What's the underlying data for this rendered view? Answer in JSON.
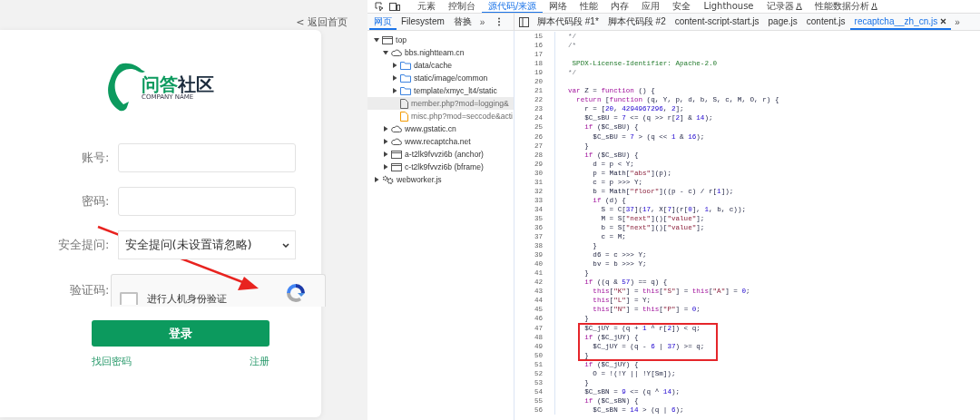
{
  "login_page": {
    "back_link": "< 返回首页",
    "logo": {
      "name_parts": [
        "问答",
        "社区"
      ],
      "tagline": "COMPANY NAME"
    },
    "fields": [
      {
        "kind": "text",
        "label": "账号:"
      },
      {
        "kind": "password",
        "label": "密码:"
      },
      {
        "kind": "select",
        "label": "安全提问:",
        "value": "安全提问(未设置请忽略)"
      },
      {
        "kind": "captcha",
        "label": "验证码:",
        "checkbox_label": "进行人机身份验证",
        "checked": false
      }
    ],
    "submit": "登录",
    "links": [
      "找回密码",
      "注册"
    ]
  },
  "devtools": {
    "panel_tabs": [
      {
        "label": "元素",
        "selected": false,
        "experimental": false
      },
      {
        "label": "控制台",
        "selected": false,
        "experimental": false
      },
      {
        "label": "源代码/来源",
        "selected": true,
        "experimental": false
      },
      {
        "label": "网络",
        "selected": false,
        "experimental": false
      },
      {
        "label": "性能",
        "selected": false,
        "experimental": false
      },
      {
        "label": "内存",
        "selected": false,
        "experimental": false
      },
      {
        "label": "应用",
        "selected": false,
        "experimental": false
      },
      {
        "label": "安全",
        "selected": false,
        "experimental": false
      },
      {
        "label": "Lighthouse",
        "selected": false,
        "experimental": false
      },
      {
        "label": "记录器",
        "selected": false,
        "experimental": true
      },
      {
        "label": "性能数据分析",
        "selected": false,
        "experimental": true
      }
    ],
    "navigator_tabs": [
      {
        "label": "网页",
        "selected": true
      },
      {
        "label": "Filesystem",
        "selected": false
      },
      {
        "label": "替换",
        "selected": false
      }
    ],
    "navigator_more": "»",
    "editor_tabs": [
      {
        "label": "脚本代码段 #1*",
        "selected": false
      },
      {
        "label": "脚本代码段 #2",
        "selected": false
      },
      {
        "label": "content-script-start.js",
        "selected": false
      },
      {
        "label": "page.js",
        "selected": false
      },
      {
        "label": "content.js",
        "selected": false
      },
      {
        "label": "recaptcha__zh_cn.js",
        "selected": true
      }
    ],
    "editor_more": "»",
    "file_tree": [
      {
        "label": "top",
        "kind": "frame",
        "expanded": true,
        "selected": false,
        "children": [
          {
            "label": "bbs.nightteam.cn",
            "kind": "domain",
            "expanded": true,
            "selected": false,
            "children": [
              {
                "label": "data/cache",
                "kind": "folder",
                "expanded": false,
                "selected": false
              },
              {
                "label": "static/image/common",
                "kind": "folder",
                "expanded": false,
                "selected": false
              },
              {
                "label": "template/xmyc_lt4/static",
                "kind": "folder",
                "expanded": false,
                "selected": false
              },
              {
                "label": "member.php?mod=logging&",
                "kind": "file",
                "selected": true
              },
              {
                "label": "misc.php?mod=seccode&acti",
                "kind": "script",
                "selected": false
              }
            ]
          },
          {
            "label": "www.gstatic.cn",
            "kind": "domain",
            "expanded": false,
            "selected": false
          },
          {
            "label": "www.recaptcha.net",
            "kind": "domain",
            "expanded": false,
            "selected": false
          },
          {
            "label": "a-t2lk9fvvzi6b (anchor)",
            "kind": "frame",
            "expanded": false,
            "selected": false
          },
          {
            "label": "c-t2lk9fvvzi6b (bframe)",
            "kind": "frame",
            "expanded": false,
            "selected": false
          }
        ]
      },
      {
        "label": "webworker.js",
        "kind": "worker",
        "expanded": false,
        "selected": false
      }
    ],
    "code_lines": [
      {
        "number": "15",
        "segments": [
          {
            "kind": "comment",
            "text": "*/"
          }
        ]
      },
      {
        "number": "16",
        "segments": [
          {
            "kind": "comment",
            "text": "/*"
          }
        ]
      },
      {
        "number": "17"
      },
      {
        "number": "18",
        "segments": [
          {
            "kind": "license",
            "text": " SPDX-License-Identifier: Apache-2.0"
          }
        ]
      },
      {
        "number": "19",
        "segments": [
          {
            "kind": "comment",
            "text": "*/"
          }
        ]
      },
      {
        "number": "20"
      },
      {
        "number": "21",
        "segments": [
          {
            "kind": "keyword",
            "text": "var"
          },
          {
            "kind": "plain",
            "text": " Z = "
          },
          {
            "kind": "keyword",
            "text": "function"
          },
          {
            "kind": "plain",
            "text": " () {"
          }
        ]
      },
      {
        "number": "22",
        "segments": [
          {
            "kind": "keyword",
            "text": "  return"
          },
          {
            "kind": "plain",
            "text": " ["
          },
          {
            "kind": "keyword",
            "text": "function"
          },
          {
            "kind": "plain",
            "text": " (q, Y, p, d, b, S, c, M, O, r) {"
          }
        ]
      },
      {
        "number": "23",
        "segments": [
          {
            "kind": "plain",
            "text": "    r = ["
          },
          {
            "kind": "number",
            "text": "20"
          },
          {
            "kind": "plain",
            "text": ", "
          },
          {
            "kind": "number",
            "text": "4294967296"
          },
          {
            "kind": "plain",
            "text": ", "
          },
          {
            "kind": "number",
            "text": "2"
          },
          {
            "kind": "plain",
            "text": "];"
          }
        ]
      },
      {
        "number": "24",
        "segments": [
          {
            "kind": "plain",
            "text": "    $C_sBU = "
          },
          {
            "kind": "number",
            "text": "7"
          },
          {
            "kind": "plain",
            "text": " <= (q >> r["
          },
          {
            "kind": "number",
            "text": "2"
          },
          {
            "kind": "plain",
            "text": "] & "
          },
          {
            "kind": "number",
            "text": "14"
          },
          {
            "kind": "plain",
            "text": ");"
          }
        ]
      },
      {
        "number": "25",
        "segments": [
          {
            "kind": "keyword",
            "text": "    if"
          },
          {
            "kind": "plain",
            "text": " ($C_sBU) {"
          }
        ]
      },
      {
        "number": "26",
        "segments": [
          {
            "kind": "plain",
            "text": "      $C_sBU = "
          },
          {
            "kind": "number",
            "text": "7"
          },
          {
            "kind": "plain",
            "text": " > (q << "
          },
          {
            "kind": "number",
            "text": "1"
          },
          {
            "kind": "plain",
            "text": " & "
          },
          {
            "kind": "number",
            "text": "16"
          },
          {
            "kind": "plain",
            "text": ");"
          }
        ]
      },
      {
        "number": "27",
        "segments": [
          {
            "kind": "plain",
            "text": "    }"
          }
        ]
      },
      {
        "number": "28",
        "segments": [
          {
            "kind": "keyword",
            "text": "    if"
          },
          {
            "kind": "plain",
            "text": " ($C_sBU) {"
          }
        ]
      },
      {
        "number": "29",
        "segments": [
          {
            "kind": "plain",
            "text": "      d = p < Y;"
          }
        ]
      },
      {
        "number": "30",
        "segments": [
          {
            "kind": "plain",
            "text": "      p = Math["
          },
          {
            "kind": "string",
            "text": "\"abs\""
          },
          {
            "kind": "plain",
            "text": "](p);"
          }
        ]
      },
      {
        "number": "31",
        "segments": [
          {
            "kind": "plain",
            "text": "      c = p >>> Y;"
          }
        ]
      },
      {
        "number": "32",
        "segments": [
          {
            "kind": "plain",
            "text": "      b = Math["
          },
          {
            "kind": "string",
            "text": "\"floor\""
          },
          {
            "kind": "plain",
            "text": "]((p - c) / r["
          },
          {
            "kind": "number",
            "text": "1"
          },
          {
            "kind": "plain",
            "text": "]);"
          }
        ]
      },
      {
        "number": "33",
        "segments": [
          {
            "kind": "keyword",
            "text": "      if"
          },
          {
            "kind": "plain",
            "text": " (d) {"
          }
        ]
      },
      {
        "number": "34",
        "segments": [
          {
            "kind": "plain",
            "text": "        S = C["
          },
          {
            "kind": "number",
            "text": "37"
          },
          {
            "kind": "plain",
            "text": "]("
          },
          {
            "kind": "number",
            "text": "17"
          },
          {
            "kind": "plain",
            "text": ", X["
          },
          {
            "kind": "number",
            "text": "7"
          },
          {
            "kind": "plain",
            "text": "](r["
          },
          {
            "kind": "number",
            "text": "0"
          },
          {
            "kind": "plain",
            "text": "], "
          },
          {
            "kind": "number",
            "text": "1"
          },
          {
            "kind": "plain",
            "text": ", b, c));"
          }
        ]
      },
      {
        "number": "35",
        "segments": [
          {
            "kind": "plain",
            "text": "        M = S["
          },
          {
            "kind": "string",
            "text": "\"next\""
          },
          {
            "kind": "plain",
            "text": "]()["
          },
          {
            "kind": "string",
            "text": "\"value\""
          },
          {
            "kind": "plain",
            "text": "];"
          }
        ]
      },
      {
        "number": "36",
        "segments": [
          {
            "kind": "plain",
            "text": "        b = S["
          },
          {
            "kind": "string",
            "text": "\"next\""
          },
          {
            "kind": "plain",
            "text": "]()["
          },
          {
            "kind": "string",
            "text": "\"value\""
          },
          {
            "kind": "plain",
            "text": "];"
          }
        ]
      },
      {
        "number": "37",
        "segments": [
          {
            "kind": "plain",
            "text": "        c = M;"
          }
        ]
      },
      {
        "number": "38",
        "segments": [
          {
            "kind": "plain",
            "text": "      }"
          }
        ]
      },
      {
        "number": "39",
        "segments": [
          {
            "kind": "plain",
            "text": "      d6 = c >>> Y;"
          }
        ]
      },
      {
        "number": "40",
        "segments": [
          {
            "kind": "plain",
            "text": "      bv = b >>> Y;"
          }
        ]
      },
      {
        "number": "41",
        "segments": [
          {
            "kind": "plain",
            "text": "    }"
          }
        ]
      },
      {
        "number": "42",
        "segments": [
          {
            "kind": "keyword",
            "text": "    if"
          },
          {
            "kind": "plain",
            "text": " ((q & "
          },
          {
            "kind": "number",
            "text": "57"
          },
          {
            "kind": "plain",
            "text": ") == q) {"
          }
        ]
      },
      {
        "number": "43",
        "segments": [
          {
            "kind": "keyword",
            "text": "      this"
          },
          {
            "kind": "plain",
            "text": "["
          },
          {
            "kind": "string",
            "text": "\"K\""
          },
          {
            "kind": "plain",
            "text": "] = "
          },
          {
            "kind": "keyword",
            "text": "this"
          },
          {
            "kind": "plain",
            "text": "["
          },
          {
            "kind": "string",
            "text": "\"S\""
          },
          {
            "kind": "plain",
            "text": "] = "
          },
          {
            "kind": "keyword",
            "text": "this"
          },
          {
            "kind": "plain",
            "text": "["
          },
          {
            "kind": "string",
            "text": "\"A\""
          },
          {
            "kind": "plain",
            "text": "] = "
          },
          {
            "kind": "number",
            "text": "0"
          },
          {
            "kind": "plain",
            "text": ";"
          }
        ]
      },
      {
        "number": "44",
        "segments": [
          {
            "kind": "keyword",
            "text": "      this"
          },
          {
            "kind": "plain",
            "text": "["
          },
          {
            "kind": "string",
            "text": "\"L\""
          },
          {
            "kind": "plain",
            "text": "] = Y;"
          }
        ]
      },
      {
        "number": "45",
        "segments": [
          {
            "kind": "keyword",
            "text": "      this"
          },
          {
            "kind": "plain",
            "text": "["
          },
          {
            "kind": "string",
            "text": "\"N\""
          },
          {
            "kind": "plain",
            "text": "] = "
          },
          {
            "kind": "keyword",
            "text": "this"
          },
          {
            "kind": "plain",
            "text": "["
          },
          {
            "kind": "string",
            "text": "\"P\""
          },
          {
            "kind": "plain",
            "text": "] = "
          },
          {
            "kind": "number",
            "text": "0"
          },
          {
            "kind": "plain",
            "text": ";"
          }
        ]
      },
      {
        "number": "46",
        "segments": [
          {
            "kind": "plain",
            "text": "    }"
          }
        ]
      },
      {
        "number": "47",
        "segments": [
          {
            "kind": "plain",
            "text": "    $C_jUY = (q + "
          },
          {
            "kind": "number",
            "text": "1"
          },
          {
            "kind": "plain",
            "text": " ^ r["
          },
          {
            "kind": "number",
            "text": "2"
          },
          {
            "kind": "plain",
            "text": "]) < q;"
          }
        ]
      },
      {
        "number": "48",
        "segments": [
          {
            "kind": "keyword",
            "text": "    if"
          },
          {
            "kind": "plain",
            "text": " ($C_jUY) {"
          }
        ]
      },
      {
        "number": "49",
        "segments": [
          {
            "kind": "plain",
            "text": "      $C_jUY = (q - "
          },
          {
            "kind": "number",
            "text": "6"
          },
          {
            "kind": "plain",
            "text": " | "
          },
          {
            "kind": "number",
            "text": "37"
          },
          {
            "kind": "plain",
            "text": ") >= q;"
          }
        ]
      },
      {
        "number": "50",
        "segments": [
          {
            "kind": "plain",
            "text": "    }"
          }
        ]
      },
      {
        "number": "51",
        "segments": [
          {
            "kind": "keyword",
            "text": "    if"
          },
          {
            "kind": "plain",
            "text": " ($C_jUY) {"
          }
        ]
      },
      {
        "number": "52",
        "segments": [
          {
            "kind": "plain",
            "text": "      O = !(!Y || !Y[Sm]);"
          }
        ]
      },
      {
        "number": "53",
        "segments": [
          {
            "kind": "plain",
            "text": "    }"
          }
        ]
      },
      {
        "number": "54",
        "segments": [
          {
            "kind": "plain",
            "text": "    $C_sBN = "
          },
          {
            "kind": "number",
            "text": "9"
          },
          {
            "kind": "plain",
            "text": " <= (q ^ "
          },
          {
            "kind": "number",
            "text": "14"
          },
          {
            "kind": "plain",
            "text": ");"
          }
        ]
      },
      {
        "number": "55",
        "segments": [
          {
            "kind": "keyword",
            "text": "    if"
          },
          {
            "kind": "plain",
            "text": " ($C_sBN) {"
          }
        ]
      },
      {
        "number": "56",
        "segments": [
          {
            "kind": "plain",
            "text": "      $C_sBN = "
          },
          {
            "kind": "number",
            "text": "14"
          },
          {
            "kind": "plain",
            "text": " > (q | "
          },
          {
            "kind": "number",
            "text": "6"
          },
          {
            "kind": "plain",
            "text": ");"
          }
        ]
      }
    ]
  }
}
